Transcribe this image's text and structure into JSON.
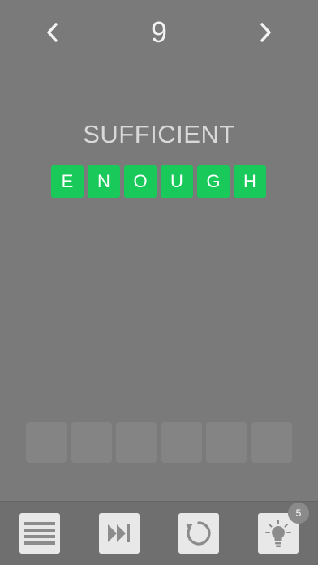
{
  "header": {
    "level": "9",
    "prev_icon": "chevron-left-icon",
    "next_icon": "chevron-right-icon"
  },
  "puzzle": {
    "clue": "SUFFICIENT",
    "answer_letters": [
      "E",
      "N",
      "O",
      "U",
      "G",
      "H"
    ],
    "answer_tile_color": "#19c95a",
    "empty_slot_count": 6
  },
  "toolbar": {
    "menu_icon": "menu-icon",
    "skip_icon": "skip-forward-icon",
    "restart_icon": "restart-icon",
    "hint_icon": "lightbulb-icon",
    "hint_count": "5"
  },
  "colors": {
    "background": "#7a7a7a",
    "toolbar_button": "#e8e8e8",
    "icon": "#8c8c8c"
  }
}
